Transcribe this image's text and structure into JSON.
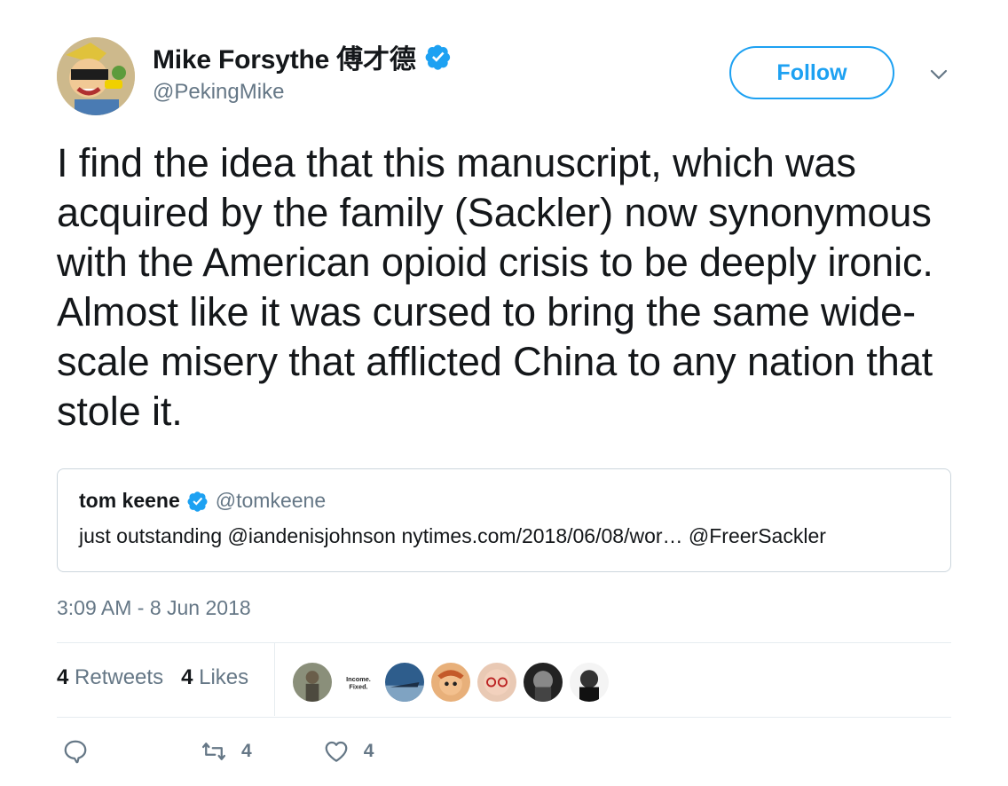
{
  "author": {
    "display_name": "Mike Forsythe 傅才德",
    "handle": "@PekingMike"
  },
  "follow_label": "Follow",
  "tweet_text": "I find the idea that this manuscript, which was acquired by the family (Sackler) now synonymous with the American opioid crisis to be deeply ironic. Almost like it was cursed to bring the same wide-scale misery that afflicted China to any nation that stole it.",
  "quote": {
    "name": "tom keene",
    "handle": "@tomkeene",
    "text": "just outstanding @iandenisjohnson nytimes.com/2018/06/08/wor… @FreerSackler"
  },
  "timestamp": "3:09 AM - 8 Jun 2018",
  "stats": {
    "retweets_count": "4",
    "retweets_label": "Retweets",
    "likes_count": "4",
    "likes_label": "Likes"
  },
  "liker_avatar_texts": {
    "income_fixed": "Income. Fixed."
  },
  "actions": {
    "reply_count": "",
    "retweet_count": "4",
    "like_count": "4"
  },
  "colors": {
    "accent": "#1da1f2",
    "secondary_text": "#657786",
    "border": "#e6ecf0"
  },
  "icons": [
    "verified-badge-icon",
    "chevron-down-icon",
    "reply-icon",
    "retweet-icon",
    "heart-icon"
  ]
}
